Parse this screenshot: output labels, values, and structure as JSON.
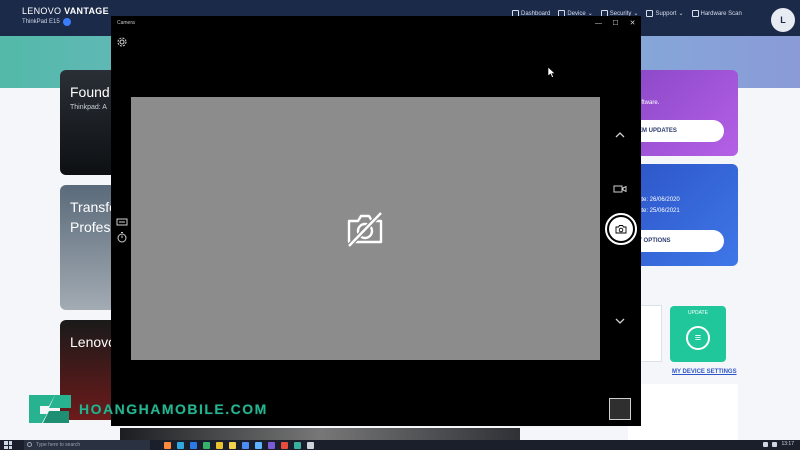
{
  "vantage": {
    "brand_prefix": "LENOVO",
    "brand_name": "VANTAGE",
    "model": "ThinkPad E15",
    "nav": [
      {
        "label": "Dashboard",
        "icon": "dashboard-icon"
      },
      {
        "label": "Device",
        "icon": "laptop-icon"
      },
      {
        "label": "Security",
        "icon": "lock-icon"
      },
      {
        "label": "Support",
        "icon": "heart-icon"
      },
      {
        "label": "Hardware Scan",
        "icon": "person-icon"
      }
    ],
    "avatar_initial": "L",
    "cards": [
      {
        "title": "Found",
        "subtitle": "Thinkpad: A"
      },
      {
        "title_line1": "Transfo",
        "title_line2": "Profes"
      },
      {
        "title": "Lenovo"
      }
    ],
    "promo_purple": {
      "text": "oftware.",
      "button": "EM UPDATES"
    },
    "promo_blue": {
      "line1": "ate: 26/06/2020",
      "line2": "ate: 25/06/2021",
      "button": "Y OPTIONS"
    },
    "update_card_label": "UPDATE",
    "device_settings_link": "MY DEVICE SETTINGS"
  },
  "camera": {
    "title": "Camera",
    "controls": {
      "minimize": "—",
      "maximize": "☐",
      "close": "✕"
    },
    "icons": [
      "gear-icon",
      "hdr-icon",
      "timer-icon",
      "no-camera-icon",
      "chevron-up-icon",
      "video-mode-icon",
      "photo-shutter-icon",
      "chevron-down-icon"
    ]
  },
  "watermark": {
    "text": "HOANGHAMOBILE.COM"
  },
  "taskbar": {
    "search_placeholder": "Type here to search",
    "clock": "13:17",
    "app_colors": [
      "#ff8a3d",
      "#2fa8e0",
      "#2c7be5",
      "#35b36a",
      "#e8c12e",
      "#f2d24a",
      "#4b8cf5",
      "#5fb4ff",
      "#7a5cd6",
      "#e74c3c",
      "#3ab0a0",
      "#d0d4da"
    ]
  },
  "colors": {
    "vantage_header": "#1c2a4a",
    "promo_purple": "#9b55d9",
    "promo_blue": "#3466d8",
    "update_green": "#1fc79a",
    "preview_gray": "#8c8c8c",
    "watermark_green": "#27b38f"
  }
}
